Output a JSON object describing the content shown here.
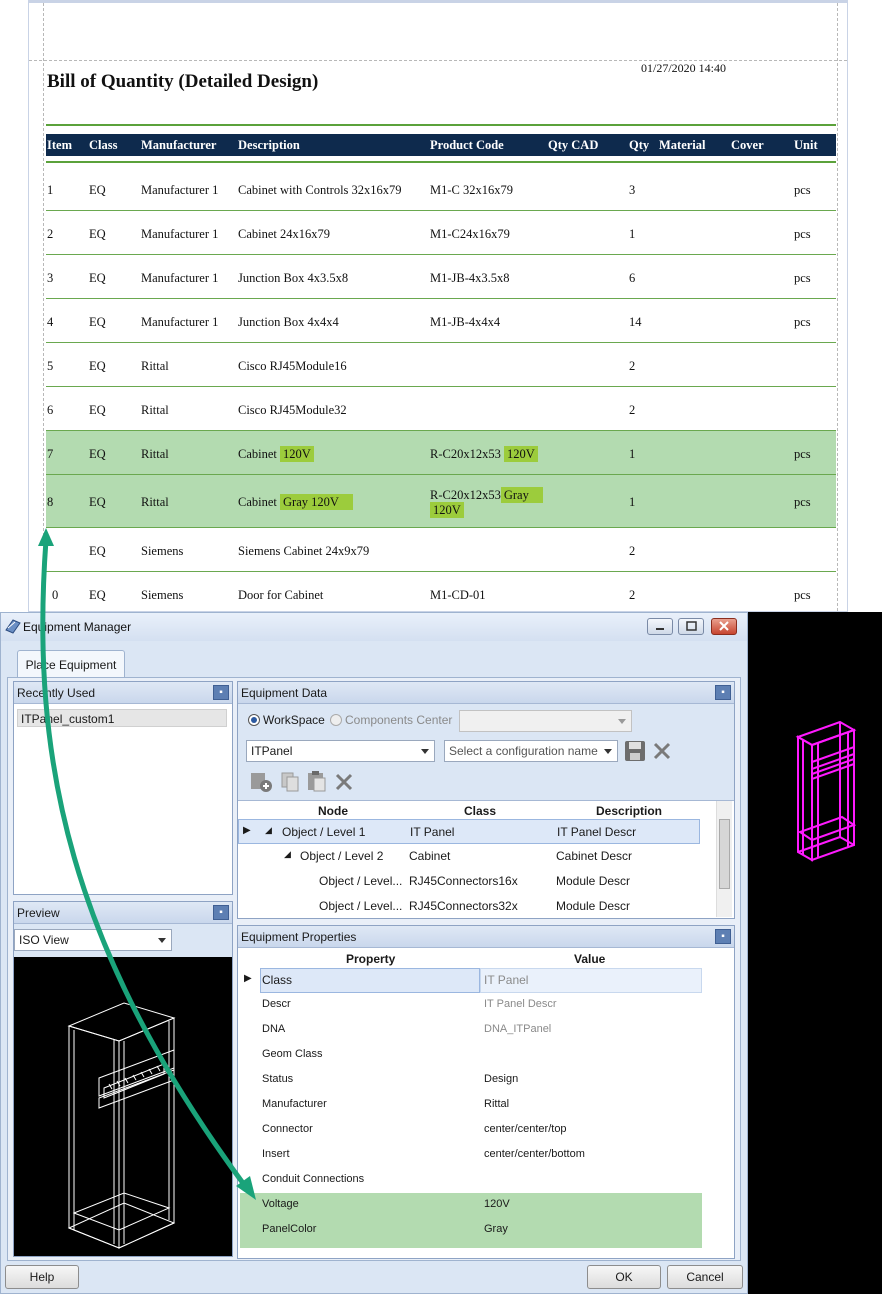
{
  "report": {
    "title": "Bill of Quantity (Detailed Design)",
    "date": "01/27/2020 14:40",
    "columns": [
      "Item",
      "Class",
      "Manufacturer",
      "Description",
      "Product Code",
      "Qty CAD",
      "Qty",
      "Material",
      "Cover",
      "Unit"
    ],
    "rows": [
      {
        "item": "1",
        "class": "EQ",
        "manufacturer": "Manufacturer 1",
        "description": "Cabinet with Controls 32x16x79",
        "code": "M1-C 32x16x79",
        "qty": "3",
        "unit": "pcs"
      },
      {
        "item": "2",
        "class": "EQ",
        "manufacturer": "Manufacturer 1",
        "description": "Cabinet 24x16x79",
        "code": "M1-C24x16x79",
        "qty": "1",
        "unit": "pcs"
      },
      {
        "item": "3",
        "class": "EQ",
        "manufacturer": "Manufacturer 1",
        "description": "Junction Box 4x3.5x8",
        "code": "M1-JB-4x3.5x8",
        "qty": "6",
        "unit": "pcs"
      },
      {
        "item": "4",
        "class": "EQ",
        "manufacturer": "Manufacturer 1",
        "description": "Junction Box 4x4x4",
        "code": "M1-JB-4x4x4",
        "qty": "14",
        "unit": "pcs"
      },
      {
        "item": "5",
        "class": "EQ",
        "manufacturer": "Rittal",
        "description": "Cisco RJ45Module16",
        "code": "",
        "qty": "2",
        "unit": ""
      },
      {
        "item": "6",
        "class": "EQ",
        "manufacturer": "Rittal",
        "description": "Cisco RJ45Module32",
        "code": "",
        "qty": "2",
        "unit": ""
      },
      {
        "item": "7",
        "class": "EQ",
        "manufacturer": "Rittal",
        "description_a": "Cabinet",
        "description_b": "120V",
        "code_a": "R-C20x12x53",
        "code_b": "120V",
        "qty": "1",
        "unit": "pcs"
      },
      {
        "item": "8",
        "class": "EQ",
        "manufacturer": "Rittal",
        "description_a": "Cabinet",
        "description_b": "Gray 120V",
        "code_a": "R-C20x12x53",
        "code_b": "Gray",
        "code_c": "120V",
        "qty": "1",
        "unit": "pcs"
      },
      {
        "item": "",
        "class": "EQ",
        "manufacturer": "Siemens",
        "description": "Siemens Cabinet 24x9x79",
        "code": "",
        "qty": "2",
        "unit": ""
      },
      {
        "item": "0",
        "class": "EQ",
        "manufacturer": "Siemens",
        "description": "Door for Cabinet",
        "code": "M1-CD-01",
        "qty": "2",
        "unit": "pcs"
      }
    ]
  },
  "dialog": {
    "title": "Equipment Manager",
    "tab": "Place Equipment",
    "recently_used": {
      "header": "Recently Used",
      "items": [
        "ITPanel_custom1"
      ]
    },
    "preview": {
      "header": "Preview",
      "view": "ISO View"
    },
    "equipment_data": {
      "header": "Equipment Data",
      "workspace_label": "WorkSpace",
      "components_label": "Components Center",
      "selected_type": "ITPanel",
      "config_placeholder": "Select a configuration name",
      "columns": [
        "Node",
        "Class",
        "Description"
      ],
      "rows": [
        {
          "node": "Object / Level 1",
          "class": "IT Panel",
          "descr": "IT Panel Descr"
        },
        {
          "node": "Object / Level 2",
          "class": "Cabinet",
          "descr": "Cabinet Descr"
        },
        {
          "node": "Object / Level...",
          "class": "RJ45Connectors16x",
          "descr": "Module Descr"
        },
        {
          "node": "Object / Level...",
          "class": "RJ45Connectors32x",
          "descr": "Module Descr"
        }
      ]
    },
    "equipment_properties": {
      "header": "Equipment Properties",
      "columns": [
        "Property",
        "Value"
      ],
      "rows": [
        {
          "property": "Class",
          "value": "IT Panel"
        },
        {
          "property": "Descr",
          "value": "IT Panel Descr"
        },
        {
          "property": "DNA",
          "value": "DNA_ITPanel"
        },
        {
          "property": "Geom Class",
          "value": ""
        },
        {
          "property": "Status",
          "value": "Design"
        },
        {
          "property": "Manufacturer",
          "value": "Rittal"
        },
        {
          "property": "Connector",
          "value": "center/center/top"
        },
        {
          "property": "Insert",
          "value": "center/center/bottom"
        },
        {
          "property": "Conduit Connections",
          "value": ""
        },
        {
          "property": "Voltage",
          "value": "120V"
        },
        {
          "property": "PanelColor",
          "value": "Gray"
        }
      ]
    },
    "buttons": {
      "help": "Help",
      "ok": "OK",
      "cancel": "Cancel"
    }
  },
  "colors": {
    "header_bar": "#0e2a4d",
    "row_rule": "#6aa84f",
    "highlight_green": "#b3dbb0",
    "highlight_yellow": "#9ccc3c",
    "arrow": "#1aa37a",
    "cad_wire": "#ff1aff"
  }
}
